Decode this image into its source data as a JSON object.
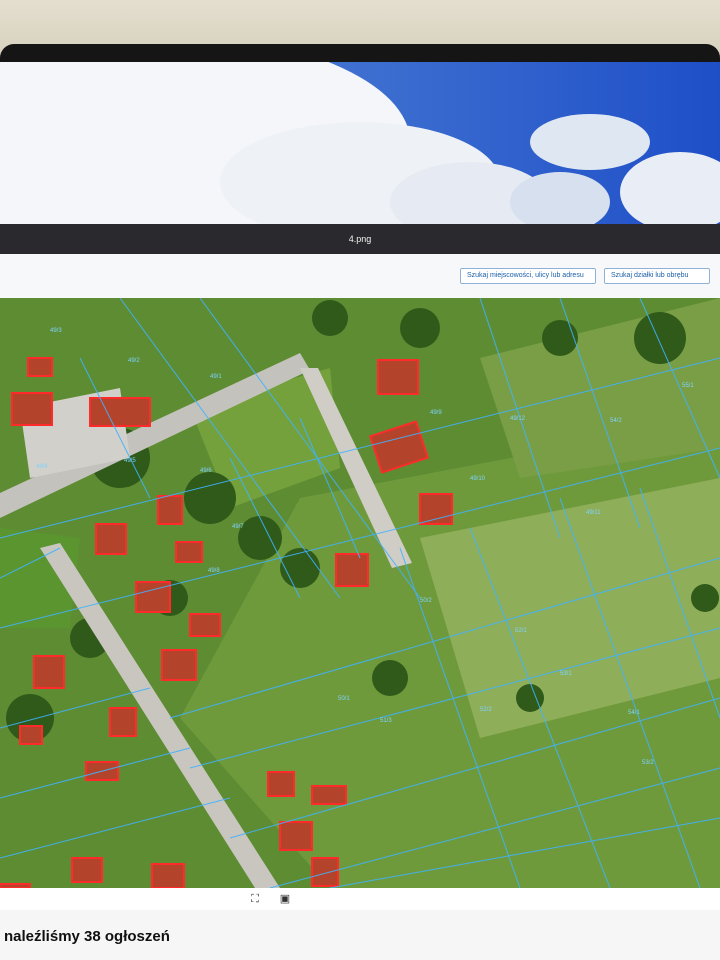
{
  "viewer": {
    "file_name": "4.png"
  },
  "search": {
    "address_button": "Szukaj miejscowości, ulicy lub adresu",
    "parcel_button": "Szukaj działki lub obrębu"
  },
  "map": {
    "parcel_labels": [
      "49/3",
      "49/2",
      "49/1",
      "49/4",
      "49/5",
      "49/6",
      "49/7",
      "49/8",
      "49/9",
      "49/10",
      "49/11",
      "49/12",
      "50/1",
      "50/2",
      "51/3",
      "52/1",
      "52/2",
      "53/1",
      "53/2",
      "54/1",
      "54/2",
      "55/1"
    ]
  },
  "controls": {
    "fit_icon": "fit-screen-icon",
    "screenshot_icon": "screenshot-icon"
  },
  "page": {
    "results_text": "naleźliśmy 38 ogłoszeń"
  }
}
